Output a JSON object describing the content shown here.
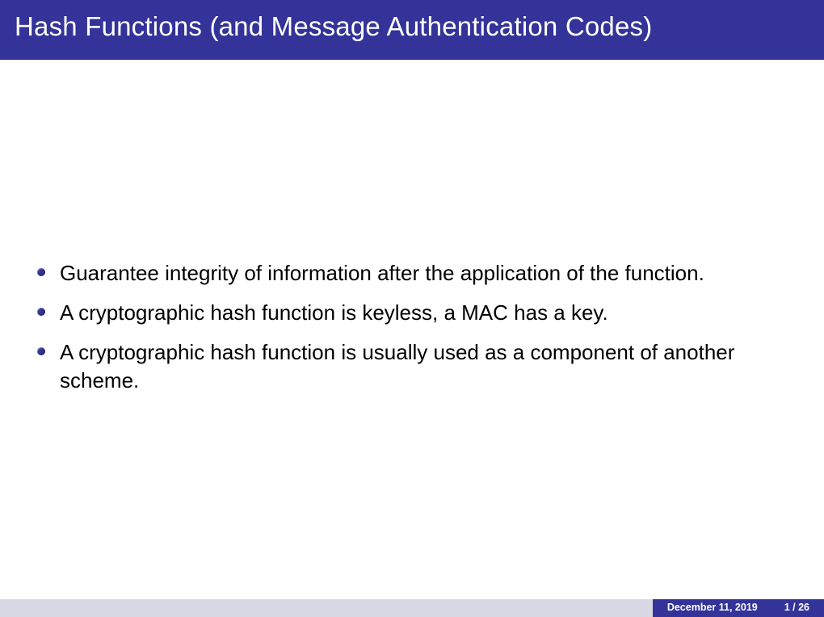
{
  "title": "Hash Functions (and Message Authentication Codes)",
  "bullets": [
    "Guarantee integrity of information after the application of the function.",
    "A cryptographic hash function is keyless, a MAC has a key.",
    "A cryptographic hash function is usually used as a component of another scheme."
  ],
  "footer": {
    "date": "December 11, 2019",
    "page": "1 / 26"
  }
}
